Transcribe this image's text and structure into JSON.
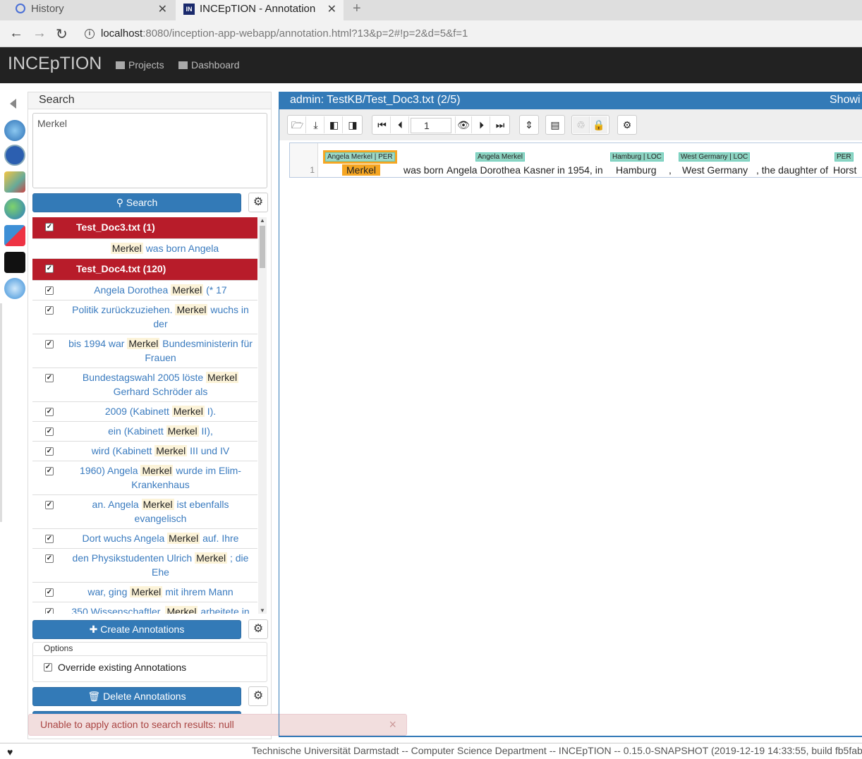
{
  "browser": {
    "tabs": [
      {
        "label": "History"
      },
      {
        "label": "INCEpTION - Annotation"
      }
    ],
    "url_host": "localhost",
    "url_rest": ":8080/inception-app-webapp/annotation.html?13&p=2#!p=2&d=5&f=1"
  },
  "navbar": {
    "brand": "INCEpTION",
    "links": [
      {
        "label": "Projects"
      },
      {
        "label": "Dashboard"
      }
    ]
  },
  "search_panel": {
    "title": "Search",
    "query": "Merkel",
    "search_button": "Search",
    "results": [
      {
        "type": "doc",
        "label": "Test_Doc3.txt (1)"
      },
      {
        "type": "hit",
        "left": "",
        "kw": "Merkel",
        "right": "was born Angela"
      },
      {
        "type": "doc",
        "label": "Test_Doc4.txt (120)"
      },
      {
        "type": "hit",
        "left": "Angela Dorothea",
        "kw": "Merkel",
        "right": "(* 17"
      },
      {
        "type": "hit",
        "left": "Politik zurückzuziehen.",
        "kw": "Merkel",
        "right": "wuchs in der"
      },
      {
        "type": "hit",
        "left": "bis 1994 war",
        "kw": "Merkel",
        "right": "Bundesministerin für Frauen"
      },
      {
        "type": "hit",
        "left": "Bundestagswahl 2005 löste",
        "kw": "Merkel",
        "right": "Gerhard Schröder als"
      },
      {
        "type": "hit",
        "left": "2009 (Kabinett",
        "kw": "Merkel",
        "right": "I)."
      },
      {
        "type": "hit",
        "left": "ein (Kabinett",
        "kw": "Merkel",
        "right": "II),"
      },
      {
        "type": "hit",
        "left": "wird (Kabinett",
        "kw": "Merkel",
        "right": "III und IV"
      },
      {
        "type": "hit",
        "left": "1960) Angela",
        "kw": "Merkel",
        "right": "wurde im Elim-Krankenhaus"
      },
      {
        "type": "hit",
        "left": "an. Angela",
        "kw": "Merkel",
        "right": "ist ebenfalls evangelisch"
      },
      {
        "type": "hit",
        "left": "Dort wuchs Angela",
        "kw": "Merkel",
        "right": "auf. Ihre"
      },
      {
        "type": "hit",
        "left": "den Physikstudenten Ulrich",
        "kw": "Merkel",
        "right": "; die Ehe"
      },
      {
        "type": "hit",
        "left": "war, ging",
        "kw": "Merkel",
        "right": "mit ihrem Mann"
      },
      {
        "type": "hit",
        "left": "350 Wissenschaftler.",
        "kw": "Merkel",
        "right": "arbeitete in"
      }
    ],
    "create_button": "Create Annotations",
    "options_title": "Options",
    "override_label": "Override existing Annotations",
    "delete_button": "Delete Annotations"
  },
  "alert": {
    "message": "Unable to apply action to search results: null",
    "close": "×"
  },
  "annotation": {
    "header": "admin: TestKB/Test_Doc3.txt (2/5)",
    "header_right": "Showi",
    "page_number": "1",
    "line_number": "1",
    "tokens": [
      {
        "text": "Merkel"
      },
      {
        "text": "was born"
      },
      {
        "text": "Angela Dorothea Kasner"
      },
      {
        "text": "in 1954, in"
      },
      {
        "text": "Hamburg"
      },
      {
        "text": ","
      },
      {
        "text": "West Germany"
      },
      {
        "text": ", the daughter of"
      },
      {
        "text": "Horst"
      }
    ],
    "labels": [
      {
        "text": "Angela Merkel | PER"
      },
      {
        "text": "Angela Merkel"
      },
      {
        "text": "Hamburg | LOC"
      },
      {
        "text": "West Germany | LOC"
      },
      {
        "text": "PER"
      }
    ]
  },
  "footer": {
    "text": "Technische Universität Darmstadt -- Computer Science Department -- INCEpTION -- 0.15.0-SNAPSHOT (2019-12-19 14:33:55, build fb5fab"
  },
  "colors": {
    "navbar_bg": "#222222",
    "primary": "#337ab7",
    "doc_row": "#b81c2a",
    "selected_annotation": "#f5a623",
    "span_label": "#8fd5c3",
    "alert_bg": "#f2dede"
  }
}
